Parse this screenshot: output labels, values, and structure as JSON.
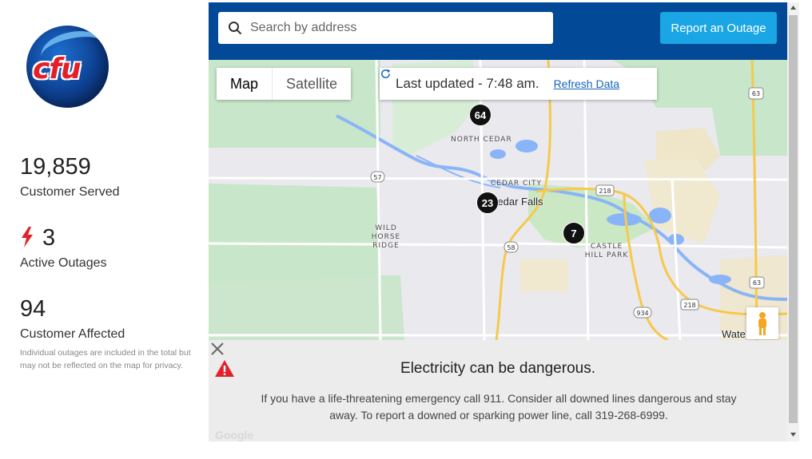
{
  "brand": {
    "logo_text": "cfu"
  },
  "stats": {
    "customers_served": {
      "value": "19,859",
      "label": "Customer Served"
    },
    "active_outages": {
      "value": "3",
      "label": "Active Outages"
    },
    "customers_affected": {
      "value": "94",
      "label": "Customer Affected"
    },
    "footnote": "Individual outages are included in the total but may not be reflected on the map for privacy."
  },
  "search": {
    "placeholder": "Search by address"
  },
  "report_button": {
    "label": "Report an Outage"
  },
  "map_type": {
    "map_label": "Map",
    "satellite_label": "Satellite",
    "selected": "Map"
  },
  "last_updated": {
    "text": "Last updated - 7:48 am.",
    "refresh_label": "Refresh Data"
  },
  "clusters": [
    {
      "count": "64"
    },
    {
      "count": "23"
    },
    {
      "count": "7"
    }
  ],
  "places": {
    "north_cedar": "NORTH CEDAR",
    "cedar_city": "CEDAR CITY",
    "cedar_falls": "Cedar Falls",
    "wild_horse_ridge": "WILD HORSE\nRIDGE",
    "castle_hill_park": "CASTLE\nHILL PARK",
    "waterloo": "Wate"
  },
  "route_shields": {
    "r57": "57",
    "r58": "58",
    "r218a": "218",
    "r218b": "218",
    "r63a": "63",
    "r63b": "63",
    "r934": "934"
  },
  "banner": {
    "title": "Electricity can be dangerous.",
    "text": "If you have a life-threatening emergency call 911. Consider all downed lines dangerous and stay away. To report a downed or sparking power line, call 319-268-6999."
  },
  "map_attribution": "Google",
  "colors": {
    "header_blue": "#024a97",
    "report_button": "#1aa6e4",
    "brand_red": "#e3202a",
    "warning_red": "#e3202a"
  }
}
